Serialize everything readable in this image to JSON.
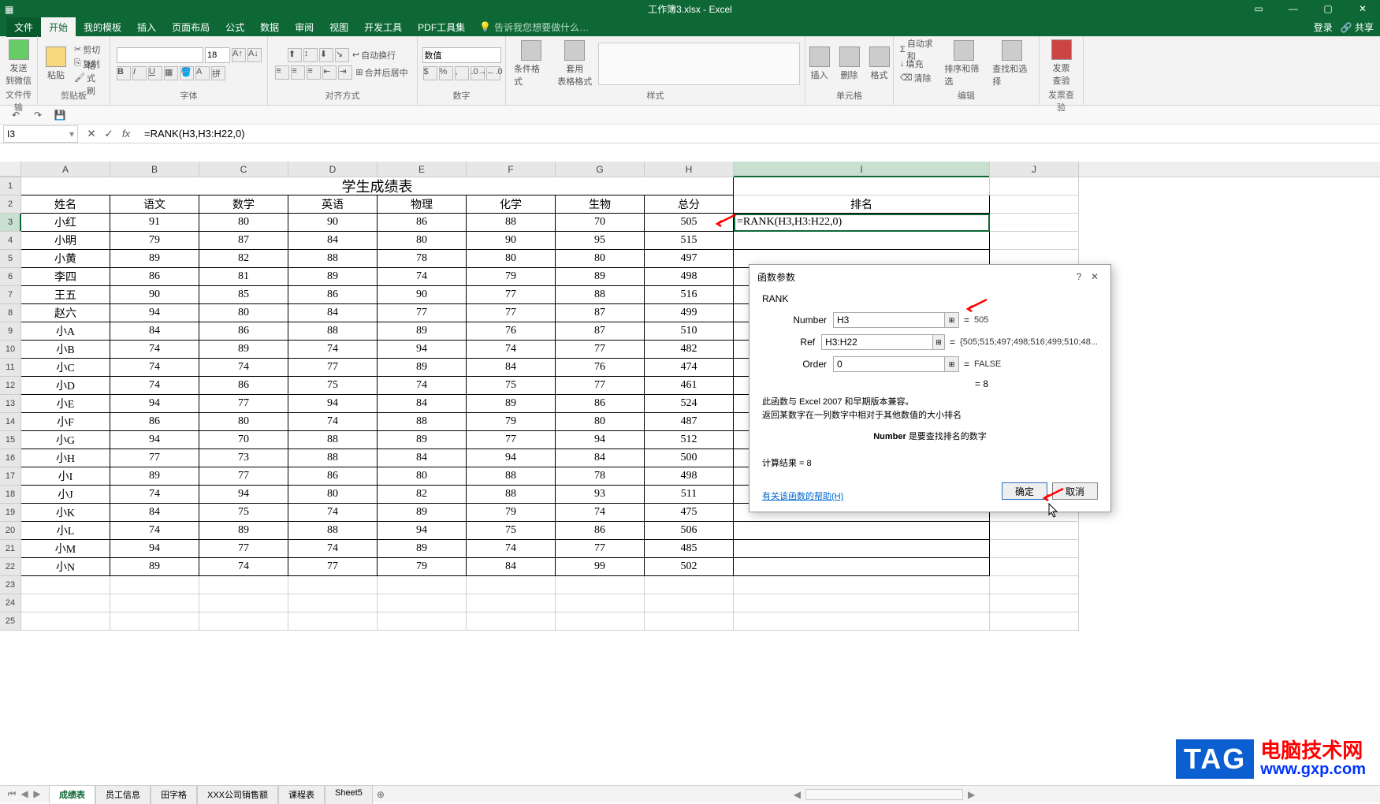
{
  "titlebar": {
    "title": "工作簿3.xlsx - Excel"
  },
  "ribbon_tabs": {
    "file": "文件",
    "items": [
      "开始",
      "我的模板",
      "插入",
      "页面布局",
      "公式",
      "数据",
      "审阅",
      "视图",
      "开发工具",
      "PDF工具集"
    ],
    "active": "开始",
    "tellme": "告诉我您想要做什么…",
    "right": [
      "登录",
      "共享"
    ]
  },
  "ribbon": {
    "groups": [
      "文件传输",
      "剪贴板",
      "字体",
      "对齐方式",
      "数字",
      "样式",
      "单元格",
      "编辑",
      "发票查验"
    ],
    "send_wechat": "发送\n到微信",
    "paste": "粘贴",
    "cut": "剪切",
    "copy": "复制",
    "format_painter": "格式刷",
    "font_name": "",
    "font_size": "18",
    "wrap": "自动换行",
    "merge": "合并后居中",
    "num_format": "数值",
    "cond_fmt": "条件格式",
    "as_table": "套用\n表格格式",
    "insert": "插入",
    "delete": "删除",
    "format": "格式",
    "autosum": "自动求和",
    "fill": "填充",
    "clear": "清除",
    "sort_filter": "排序和筛选",
    "find_select": "查找和选择",
    "invoice": "发票\n查验"
  },
  "formula_bar": {
    "name_box": "I3",
    "formula": "=RANK(H3,H3:H22,0)"
  },
  "chart_data": {
    "type": "table",
    "title": "学生成绩表",
    "columns": [
      "姓名",
      "语文",
      "数学",
      "英语",
      "物理",
      "化学",
      "生物",
      "总分",
      "排名"
    ],
    "rows": [
      [
        "小红",
        91,
        80,
        90,
        86,
        88,
        70,
        505,
        ""
      ],
      [
        "小明",
        79,
        87,
        84,
        80,
        90,
        95,
        515,
        ""
      ],
      [
        "小黄",
        89,
        82,
        88,
        78,
        80,
        80,
        497,
        ""
      ],
      [
        "李四",
        86,
        81,
        89,
        74,
        79,
        89,
        498,
        ""
      ],
      [
        "王五",
        90,
        85,
        86,
        90,
        77,
        88,
        516,
        ""
      ],
      [
        "赵六",
        94,
        80,
        84,
        77,
        77,
        87,
        499,
        ""
      ],
      [
        "小A",
        84,
        86,
        88,
        89,
        76,
        87,
        510,
        ""
      ],
      [
        "小B",
        74,
        89,
        74,
        94,
        74,
        77,
        482,
        ""
      ],
      [
        "小C",
        74,
        74,
        77,
        89,
        84,
        76,
        474,
        ""
      ],
      [
        "小D",
        74,
        86,
        75,
        74,
        75,
        77,
        461,
        ""
      ],
      [
        "小E",
        94,
        77,
        94,
        84,
        89,
        86,
        524,
        ""
      ],
      [
        "小F",
        86,
        80,
        74,
        88,
        79,
        80,
        487,
        ""
      ],
      [
        "小G",
        94,
        70,
        88,
        89,
        77,
        94,
        512,
        ""
      ],
      [
        "小H",
        77,
        73,
        88,
        84,
        94,
        84,
        500,
        ""
      ],
      [
        "小I",
        89,
        77,
        86,
        80,
        88,
        78,
        498,
        ""
      ],
      [
        "小J",
        74,
        94,
        80,
        82,
        88,
        93,
        511,
        ""
      ],
      [
        "小K",
        84,
        75,
        74,
        89,
        79,
        74,
        475,
        ""
      ],
      [
        "小L",
        74,
        89,
        88,
        94,
        75,
        86,
        506,
        ""
      ],
      [
        "小M",
        94,
        77,
        74,
        89,
        74,
        77,
        485,
        ""
      ],
      [
        "小N",
        89,
        74,
        77,
        79,
        84,
        99,
        502,
        ""
      ]
    ]
  },
  "active_cell_display": "=RANK(H3,H3:H22,0)",
  "sheets": {
    "tabs": [
      "成绩表",
      "员工信息",
      "田字格",
      "XXX公司销售额",
      "课程表",
      "Sheet5"
    ],
    "active": "成绩表"
  },
  "dialog": {
    "title": "函数参数",
    "func_name": "RANK",
    "args": [
      {
        "label": "Number",
        "value": "H3",
        "result": "505"
      },
      {
        "label": "Ref",
        "value": "H3:H22",
        "result": "{505;515;497;498;516;499;510;48..."
      },
      {
        "label": "Order",
        "value": "0",
        "result": "FALSE"
      }
    ],
    "preview": "= 8",
    "desc1": "此函数与 Excel 2007 和早期版本兼容。",
    "desc2": "返回某数字在一列数字中相对于其他数值的大小排名",
    "arg_desc_label": "Number",
    "arg_desc": "是要查找排名的数字",
    "calc_label": "计算结果 = ",
    "calc_value": "8",
    "help_link": "有关该函数的帮助(H)",
    "ok": "确定",
    "cancel": "取消"
  },
  "col_widths": {
    "A": 113,
    "B": 113,
    "C": 113,
    "D": 113,
    "E": 113,
    "F": 113,
    "G": 113,
    "H": 113,
    "I": 325,
    "J": 113
  }
}
